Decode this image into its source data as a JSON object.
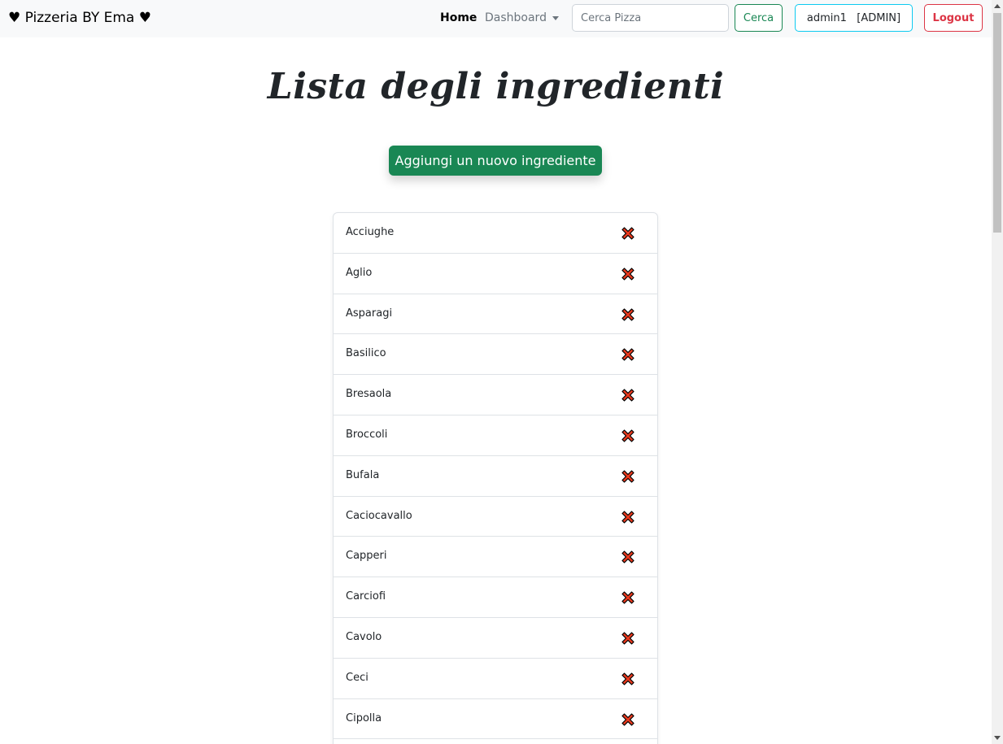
{
  "navbar": {
    "brand": "♥ Pizzeria BY Ema ♥",
    "home_label": "Home",
    "dashboard_label": "Dashboard",
    "search_placeholder": "Cerca Pizza",
    "search_button": "Cerca",
    "user_label": "admin1   [ADMIN]",
    "logout_label": "Logout"
  },
  "page": {
    "title": "Lista degli ingredienti",
    "add_button": "Aggiungi un nuovo ingrediente"
  },
  "ingredients": [
    "Acciughe",
    "Aglio",
    "Asparagi",
    "Basilico",
    "Bresaola",
    "Broccoli",
    "Bufala",
    "Caciocavallo",
    "Capperi",
    "Carciofi",
    "Cavolo",
    "Ceci",
    "Cipolla"
  ],
  "icons": {
    "delete": "delete-icon",
    "dropdown": "chevron-down-icon"
  },
  "colors": {
    "success": "#198754",
    "danger": "#dc3545",
    "info": "#0dcaf0",
    "delete_fill": "#e8391e"
  }
}
